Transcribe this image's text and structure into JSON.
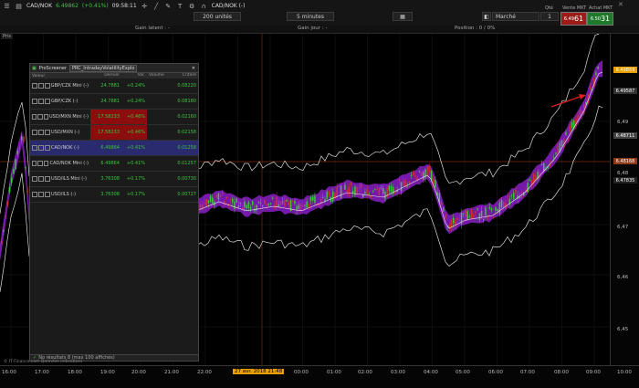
{
  "topbar": {
    "instrument": "CAD/NOK",
    "price": "6.49862",
    "change": "(+0.41%)",
    "time": "09:58:11",
    "instrument2": "CAD/NOK (-)",
    "units": "200 unités",
    "interval": "5 minutes",
    "market": "Marché",
    "qty_label": "Qté",
    "qty": "1",
    "sell_label": "Vente MKT",
    "sell_big": "61",
    "sell_small": "6.49",
    "buy_label": "Achat MKT",
    "buy_big": "31",
    "buy_small": "6.50",
    "prix": "Prix"
  },
  "infobar": {
    "gain_latent": "Gain latent : -",
    "gain_jour": "Gain jour : -",
    "position": "Position : 0 / 0%"
  },
  "colors": {
    "up": "#3ec43e",
    "down": "#d03030",
    "band": "#8a1fc6",
    "price_tag": "#e8a000"
  },
  "yaxis": {
    "labels": [
      "6,49",
      "6,48",
      "6,47",
      "6,46",
      "6,45"
    ],
    "tags": [
      {
        "text": "6.49859",
        "color": "#e8a000"
      },
      {
        "text": "6.49587",
        "color": "#333"
      },
      {
        "text": "6.48711",
        "color": "#444"
      },
      {
        "text": "6.48168",
        "color": "#8b3a1a"
      },
      {
        "text": "6.47835",
        "color": "#222"
      }
    ]
  },
  "xaxis": {
    "labels": [
      "16:00",
      "17:00",
      "18:00",
      "19:00",
      "20:00",
      "21:00",
      "22:00",
      "23:00",
      "00:00",
      "01:00",
      "02:00",
      "03:00",
      "04:00",
      "05:00",
      "06:00",
      "07:00",
      "08:00",
      "09:00",
      "10:00"
    ],
    "cursor_date": "27 avr. 2018 21:48"
  },
  "panel": {
    "title": "ProScreener",
    "screen_name": "PRC_IntradayVolatilityExplo",
    "columns": [
      "Valeur",
      "Dernier",
      "Var.",
      "Volume",
      "Critère"
    ],
    "rows": [
      {
        "name": "GBP/CZK Mini (-)",
        "last": "24.7881",
        "var": "+0.24%",
        "vol": "",
        "crit": "0.08220",
        "red": false,
        "sel": false
      },
      {
        "name": "GBP/CZK (-)",
        "last": "24.7881",
        "var": "+0.24%",
        "vol": "",
        "crit": "0.08180",
        "red": false,
        "sel": false
      },
      {
        "name": "USD/MXN Mini (-)",
        "last": "17.58233",
        "var": "+0.46%",
        "vol": "",
        "crit": "0.02160",
        "red": true,
        "sel": false
      },
      {
        "name": "USD/MXN (-)",
        "last": "17.58233",
        "var": "+0.46%",
        "vol": "",
        "crit": "0.02158",
        "red": true,
        "sel": false
      },
      {
        "name": "CAD/NOK (-)",
        "last": "6.49864",
        "var": "+0.41%",
        "vol": "",
        "crit": "0.01258",
        "red": false,
        "sel": true
      },
      {
        "name": "CAD/NOK Mini (-)",
        "last": "6.49864",
        "var": "+0.41%",
        "vol": "",
        "crit": "0.01257",
        "red": false,
        "sel": false
      },
      {
        "name": "USD/ILS Mini (-)",
        "last": "3.76308",
        "var": "+0.17%",
        "vol": "",
        "crit": "0.00730",
        "red": false,
        "sel": false
      },
      {
        "name": "USD/ILS (-)",
        "last": "3.76308",
        "var": "+0.17%",
        "vol": "",
        "crit": "0.00727",
        "red": false,
        "sel": false
      }
    ],
    "footer": "No résultats  8 (max 100 affichés)"
  },
  "chart_label": "Prix",
  "footer_text": "© IT-Finance.com Données indicatives"
}
